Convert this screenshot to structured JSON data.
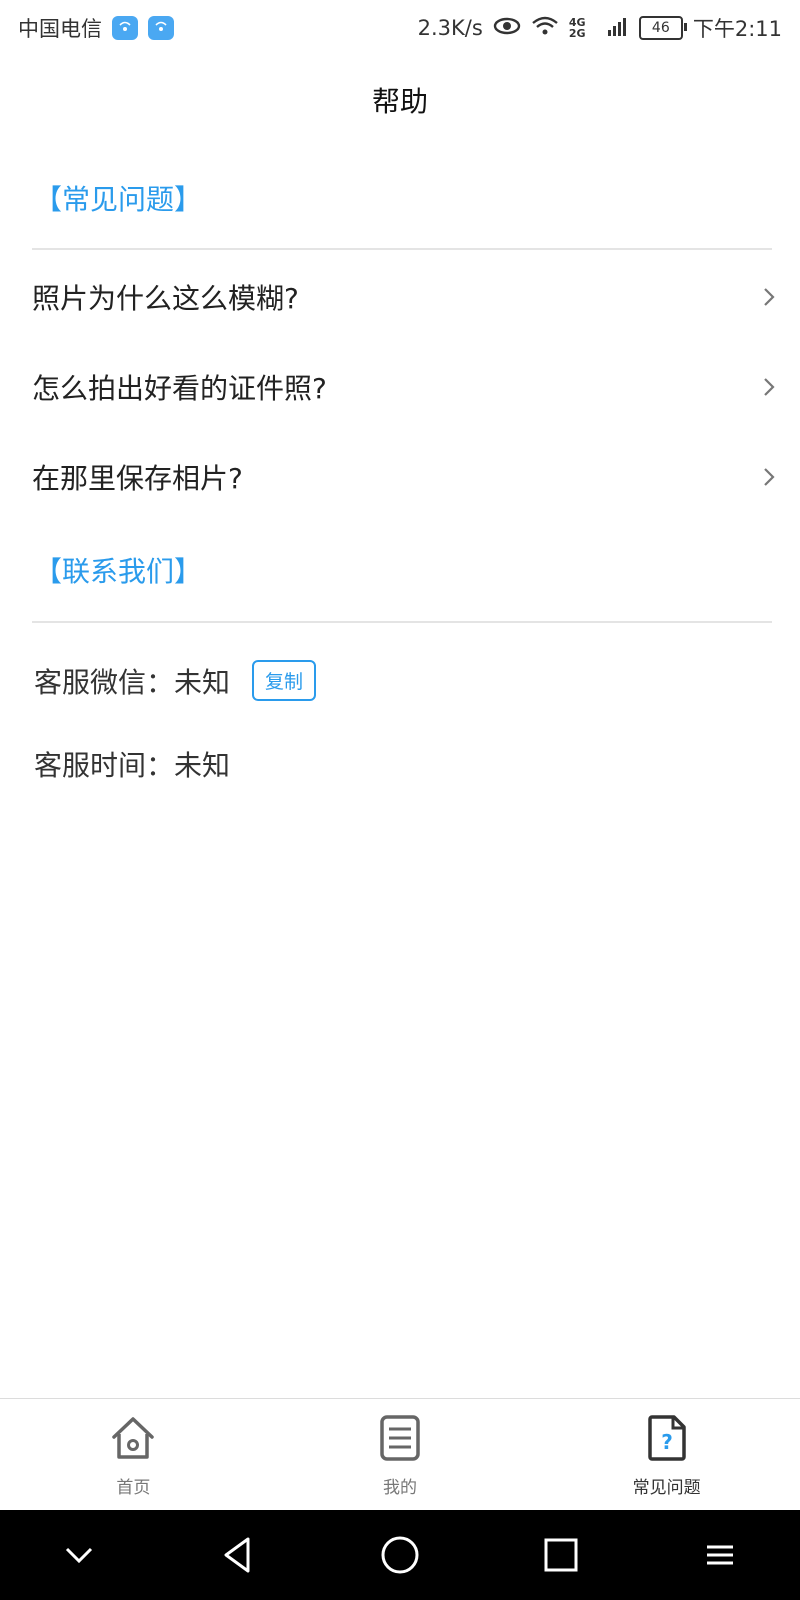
{
  "status_bar": {
    "carrier": "中国电信",
    "speed": "2.3K/s",
    "network": "4G 2G",
    "battery": "46",
    "time": "下午2:11"
  },
  "header": {
    "title": "帮助"
  },
  "faq": {
    "section_title": "【常见问题】",
    "items": [
      {
        "label": "照片为什么这么模糊?"
      },
      {
        "label": "怎么拍出好看的证件照?"
      },
      {
        "label": "在那里保存相片?"
      }
    ]
  },
  "contact": {
    "section_title": "【联系我们】",
    "wechat_label": "客服微信：",
    "wechat_value": "未知",
    "copy_label": "复制",
    "time_label": "客服时间：",
    "time_value": "未知"
  },
  "tabs": [
    {
      "label": "首页",
      "icon": "home-icon",
      "active": false
    },
    {
      "label": "我的",
      "icon": "document-list-icon",
      "active": false
    },
    {
      "label": "常见问题",
      "icon": "question-document-icon",
      "active": true
    }
  ],
  "colors": {
    "accent": "#2a9bec",
    "nav_background": "#000000"
  }
}
